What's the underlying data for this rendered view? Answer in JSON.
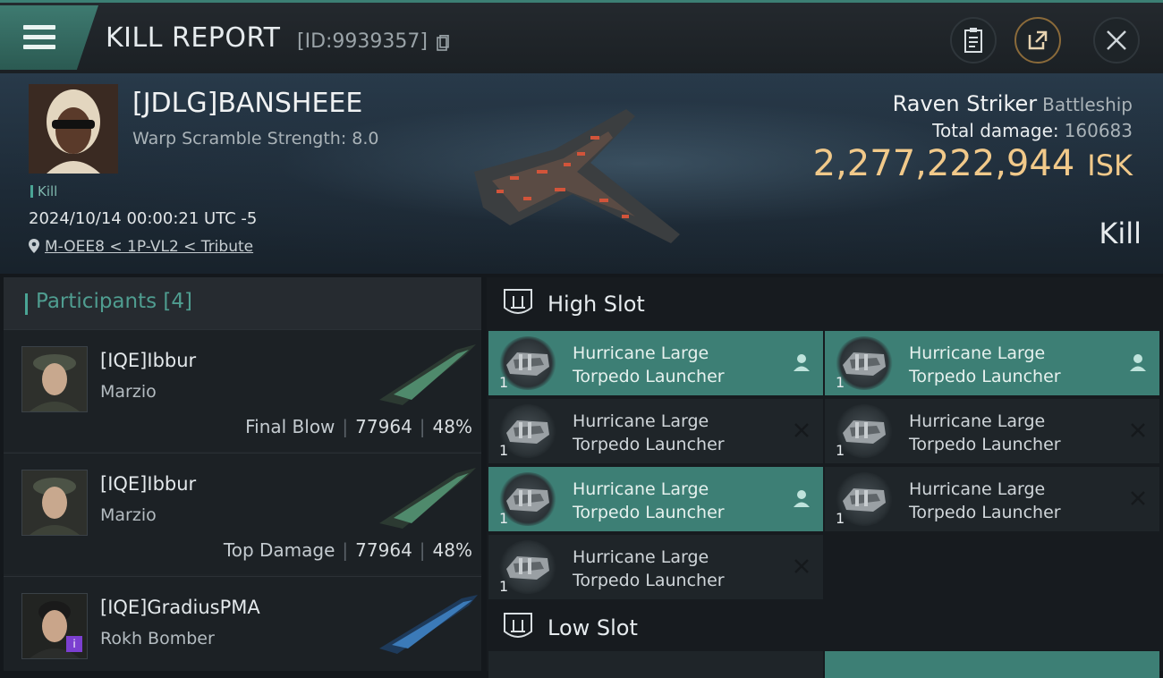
{
  "header": {
    "title": "KILL REPORT",
    "report_id": "[ID:9939357]"
  },
  "victim": {
    "name": "[JDLG]BANSHEEE",
    "warp_scramble": "Warp Scramble Strength: 8.0",
    "kill_tag": "Kill",
    "datetime": "2024/10/14 00:00:21 UTC -5",
    "location": "M-OEE8 < 1P-VL2 < Tribute"
  },
  "summary": {
    "ship_name": "Raven Striker",
    "ship_class": "Battleship",
    "total_damage_label": "Total damage:",
    "total_damage": "160683",
    "isk_value": "2,277,222,944",
    "isk_unit": "ISK",
    "result": "Kill"
  },
  "participants": {
    "header": "Participants",
    "count": "[4]",
    "rows": [
      {
        "name": "[IQE]Ibbur",
        "ship": "Marzio",
        "role": "Final Blow",
        "damage": "77964",
        "percent": "48%"
      },
      {
        "name": "[IQE]Ibbur",
        "ship": "Marzio",
        "role": "Top Damage",
        "damage": "77964",
        "percent": "48%"
      },
      {
        "name": "[IQE]GradiusPMA",
        "ship": "Rokh Bomber",
        "badge": "i"
      }
    ]
  },
  "slots": {
    "high_slot_label": "High Slot",
    "low_slot_label": "Low Slot",
    "high_items": [
      {
        "line1": "Hurricane Large",
        "line2": "Torpedo Launcher",
        "qty": "1",
        "state": "dropped"
      },
      {
        "line1": "Hurricane Large",
        "line2": "Torpedo Launcher",
        "qty": "1",
        "state": "dropped"
      },
      {
        "line1": "Hurricane Large",
        "line2": "Torpedo Launcher",
        "qty": "1",
        "state": "destroyed"
      },
      {
        "line1": "Hurricane Large",
        "line2": "Torpedo Launcher",
        "qty": "1",
        "state": "destroyed"
      },
      {
        "line1": "Hurricane Large",
        "line2": "Torpedo Launcher",
        "qty": "1",
        "state": "dropped"
      },
      {
        "line1": "Hurricane Large",
        "line2": "Torpedo Launcher",
        "qty": "1",
        "state": "destroyed"
      },
      {
        "line1": "Hurricane Large",
        "line2": "Torpedo Launcher",
        "qty": "1",
        "state": "destroyed"
      }
    ]
  },
  "colors": {
    "accent": "#3d7f75",
    "isk": "#f1c98a"
  },
  "icons": [
    "menu-icon",
    "copy-icon",
    "clipboard-icon",
    "share-icon",
    "close-icon",
    "location-pin-icon",
    "slot-shield-icon",
    "person-icon",
    "x-icon"
  ]
}
